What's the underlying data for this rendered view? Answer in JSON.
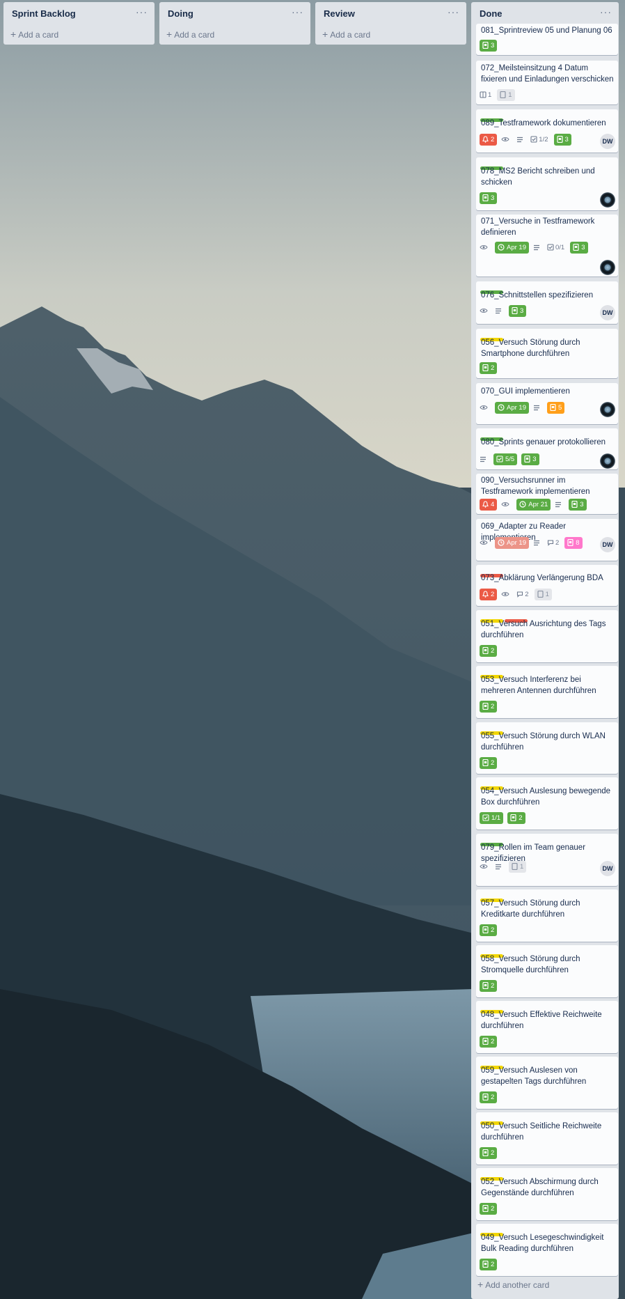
{
  "lists": [
    {
      "title": "Sprint Backlog",
      "add_label": "Add a card"
    },
    {
      "title": "Doing",
      "add_label": "Add a card"
    },
    {
      "title": "Review",
      "add_label": "Add a card"
    },
    {
      "title": "Done",
      "add_another_label": "Add another card"
    }
  ],
  "list_menu_glyph": "···",
  "add_plus": "+",
  "colors": {
    "green": "#5aac44",
    "red": "#eb5a46",
    "yellow": "#f2d600",
    "orange": "#ff9f1a",
    "pink": "#ff78cb"
  },
  "cards": [
    {
      "title": "081_Sprintreview 05 und Planung 06",
      "stories": "3"
    },
    {
      "title": "072_Meilsteinsitzung 4 Datum fixieren und Einladungen verschicken",
      "desc_count": "1",
      "stories_gray": "1"
    },
    {
      "title": "089_Testframework dokumentieren",
      "label": "green",
      "alert": "2",
      "checklist": "1/2",
      "stories": "3",
      "member": "DW"
    },
    {
      "title": "078_MS2 Bericht schreiben und schicken",
      "label": "green",
      "stories": "3",
      "member_icon": "eye-avatar"
    },
    {
      "title": "071_Versuche in Testframework definieren",
      "due": "Apr 19",
      "checklist": "0/1",
      "stories": "3",
      "member_icon": "eye-avatar"
    },
    {
      "title": "076_Schnittstellen spezifizieren",
      "label": "green",
      "stories": "3",
      "member": "DW"
    },
    {
      "title": "056_Versuch Störung durch Smartphone durchführen",
      "label": "yellow",
      "stories": "2"
    },
    {
      "title": "070_GUI implementieren",
      "due": "Apr 19",
      "stories": "5",
      "member_icon": "eye-avatar"
    },
    {
      "title": "080_Sprints genauer protokollieren",
      "label": "green",
      "checklist": "5/5",
      "stories": "3",
      "member_icon": "eye-avatar"
    },
    {
      "title": "090_Versuchsrunner im Testframework implementieren",
      "alert": "4",
      "due": "Apr 21",
      "stories": "3"
    },
    {
      "title": "069_Adapter zu Reader implementieren",
      "due": "Apr 19",
      "comments": "2",
      "stories": "8",
      "member": "DW"
    },
    {
      "title": "073_Abklärung Verlängerung BDA",
      "label": "red",
      "alert": "2",
      "comments": "2",
      "stories_gray": "1"
    },
    {
      "title": "051_Versuch Ausrichtung des Tags durchführen",
      "labels": [
        "yellow",
        "red"
      ],
      "stories": "2"
    },
    {
      "title": "053_Versuch Interferenz bei mehreren Antennen durchführen",
      "label": "yellow",
      "stories": "2"
    },
    {
      "title": "055_Versuch Störung durch WLAN durchführen",
      "label": "yellow",
      "stories": "2"
    },
    {
      "title": "054_Versuch Auslesung bewegende Box durchführen",
      "label": "yellow",
      "checklist": "1/1",
      "stories": "2"
    },
    {
      "title": "079_Rollen im Team genauer spezifizieren",
      "label": "green",
      "stories_gray": "1",
      "member": "DW"
    },
    {
      "title": "057_Versuch Störung durch Kreditkarte durchführen",
      "label": "yellow",
      "stories": "2"
    },
    {
      "title": "058_Versuch Störung durch Stromquelle durchführen",
      "label": "yellow",
      "stories": "2"
    },
    {
      "title": "048_Versuch Effektive Reichweite durchführen",
      "label": "yellow",
      "stories": "2"
    },
    {
      "title": "059_Versuch Auslesen von gestapelten Tags durchführen",
      "label": "yellow",
      "stories": "2"
    },
    {
      "title": "050_Versuch Seitliche Reichweite durchführen",
      "label": "yellow",
      "stories": "2"
    },
    {
      "title": "052_Versuch Abschirmung durch Gegenstände durchführen",
      "label": "yellow",
      "stories": "2"
    },
    {
      "title": "049_Versuch Lesegeschwindigkeit Bulk Reading durchführen",
      "label": "yellow",
      "stories": "2"
    }
  ]
}
